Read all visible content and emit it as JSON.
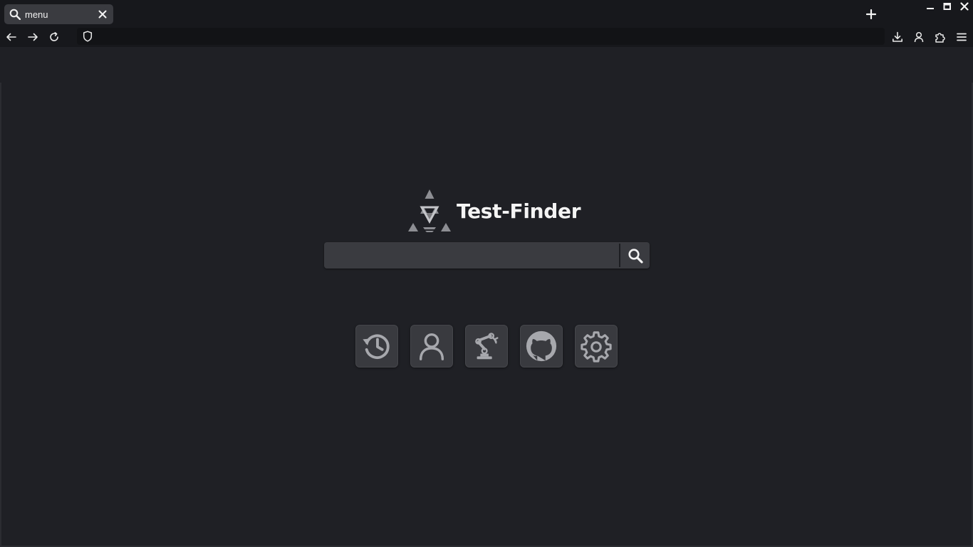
{
  "browser": {
    "tab": {
      "title": "menu",
      "icon": "search-icon"
    },
    "url": {
      "value": "",
      "placeholder": ""
    }
  },
  "page": {
    "brand_name": "Test-Finder",
    "search": {
      "value": "",
      "placeholder": ""
    },
    "shortcuts": [
      {
        "icon": "history-icon"
      },
      {
        "icon": "user-icon"
      },
      {
        "icon": "robot-arm-icon"
      },
      {
        "icon": "github-icon"
      },
      {
        "icon": "settings-gear-icon"
      }
    ]
  },
  "colors": {
    "background": "#1f2025",
    "chrome": "#17181c",
    "tab_active": "#3a3b40",
    "search_field": "#3a3b40",
    "shortcut_tile": "#393a3f",
    "icon": "#a7a8ad"
  }
}
